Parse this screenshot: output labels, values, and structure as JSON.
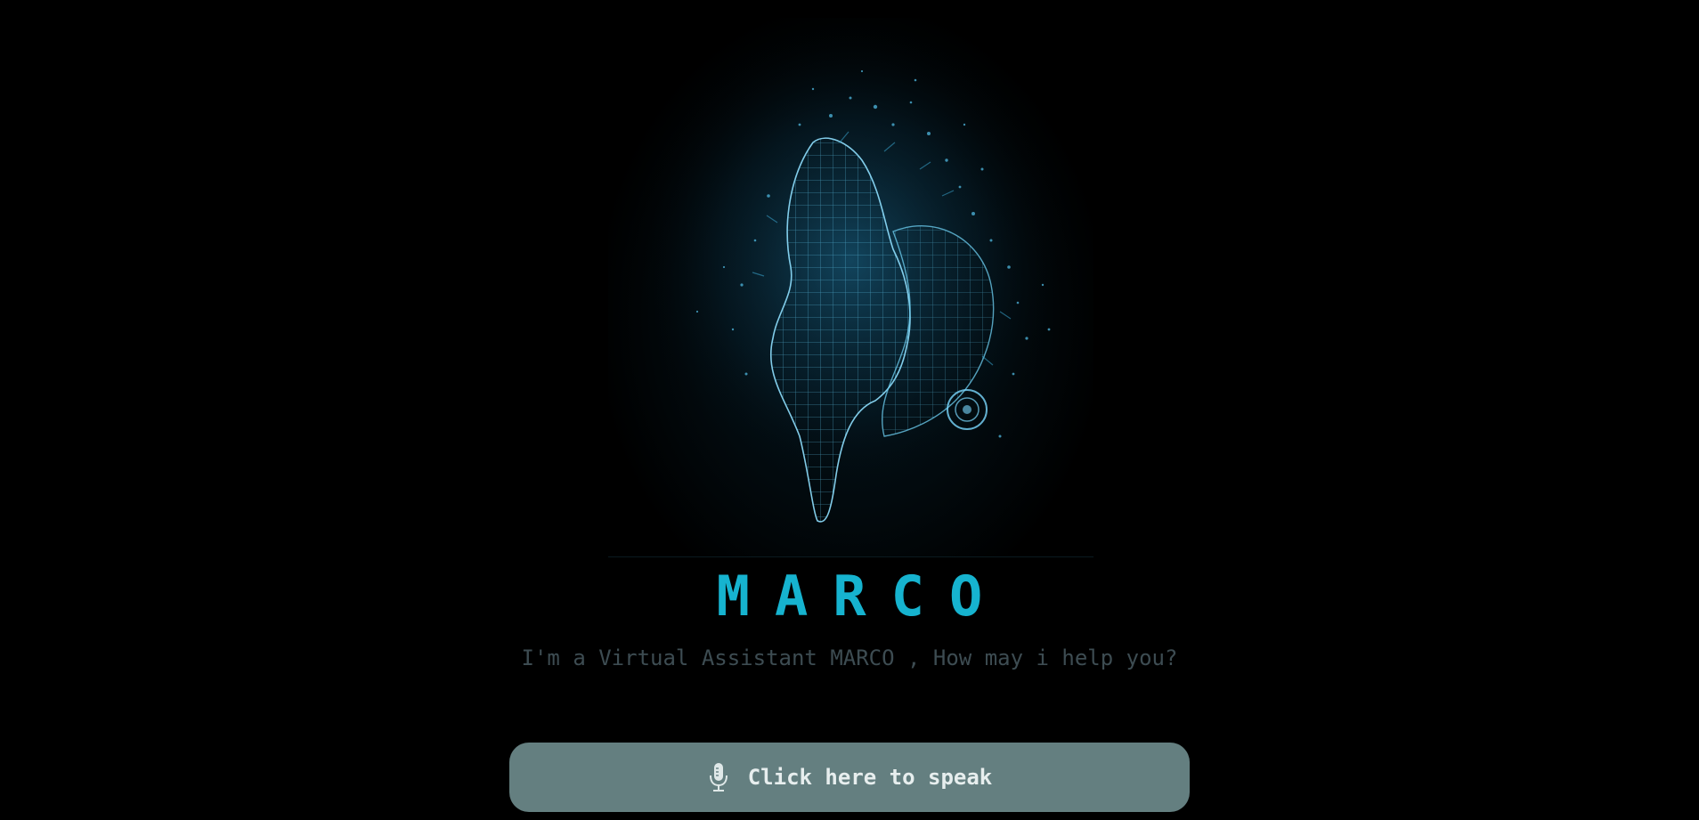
{
  "assistant": {
    "name": "MARCO",
    "greeting": "I'm a Virtual Assistant MARCO , How may i help you?"
  },
  "speak_button": {
    "label": "Click here to speak",
    "icon": "microphone-icon"
  },
  "hero_image": {
    "subject": "wireframe hologram figure",
    "icon": "hologram-figure-image"
  },
  "colors": {
    "background": "#000000",
    "accent": "#16b3cf",
    "subtitle": "#3d4c52",
    "button_bg": "#647f80",
    "button_text": "#e7eeee"
  }
}
